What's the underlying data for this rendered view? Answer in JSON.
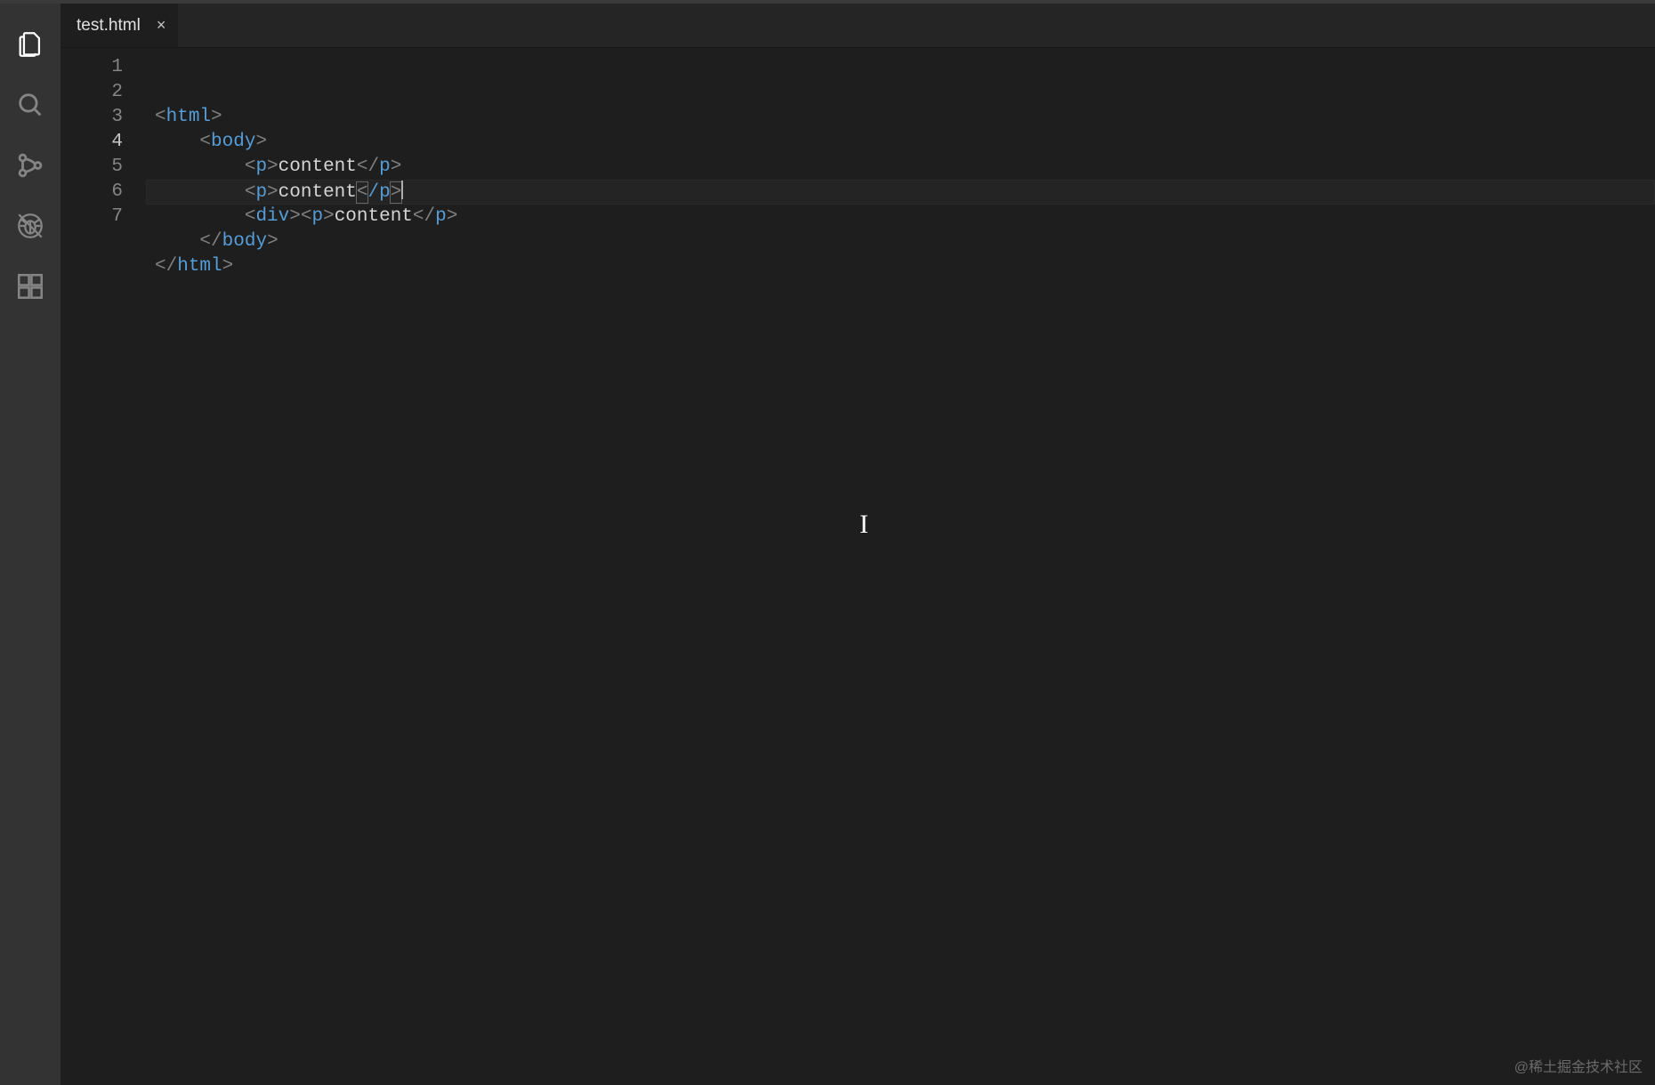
{
  "activitybar": {
    "items": [
      {
        "name": "files-icon",
        "active": true
      },
      {
        "name": "search-icon",
        "active": false
      },
      {
        "name": "source-control-icon",
        "active": false
      },
      {
        "name": "debug-icon",
        "active": false
      },
      {
        "name": "extensions-icon",
        "active": false
      }
    ]
  },
  "tabs": [
    {
      "label": "test.html",
      "active": true,
      "close_icon": "×"
    }
  ],
  "editor": {
    "filename": "test.html",
    "current_line": 4,
    "cursor_col_after_segment": 6,
    "line_numbers": [
      "1",
      "2",
      "3",
      "4",
      "5",
      "6",
      "7"
    ],
    "lines": [
      {
        "indent": 0,
        "segments": [
          {
            "t": "bracket",
            "v": "<"
          },
          {
            "t": "tag",
            "v": "html"
          },
          {
            "t": "bracket",
            "v": ">"
          }
        ]
      },
      {
        "indent": 1,
        "segments": [
          {
            "t": "bracket",
            "v": "<"
          },
          {
            "t": "tag",
            "v": "body"
          },
          {
            "t": "bracket",
            "v": ">"
          }
        ]
      },
      {
        "indent": 2,
        "segments": [
          {
            "t": "bracket",
            "v": "<"
          },
          {
            "t": "tag",
            "v": "p"
          },
          {
            "t": "bracket",
            "v": ">"
          },
          {
            "t": "text",
            "v": "content"
          },
          {
            "t": "bracket",
            "v": "</"
          },
          {
            "t": "tag",
            "v": "p"
          },
          {
            "t": "bracket",
            "v": ">"
          }
        ]
      },
      {
        "indent": 2,
        "current": true,
        "segments": [
          {
            "t": "bracket",
            "v": "<"
          },
          {
            "t": "tag",
            "v": "p"
          },
          {
            "t": "bracket",
            "v": ">"
          },
          {
            "t": "text",
            "v": "content"
          },
          {
            "t": "bracket",
            "v": "<",
            "match": true
          },
          {
            "t": "tag",
            "v": "/p"
          },
          {
            "t": "bracket",
            "v": ">",
            "match": true
          },
          {
            "t": "cursor"
          }
        ]
      },
      {
        "indent": 2,
        "segments": [
          {
            "t": "bracket",
            "v": "<"
          },
          {
            "t": "tag",
            "v": "div"
          },
          {
            "t": "bracket",
            "v": ">"
          },
          {
            "t": "bracket",
            "v": "<"
          },
          {
            "t": "tag",
            "v": "p"
          },
          {
            "t": "bracket",
            "v": ">"
          },
          {
            "t": "text",
            "v": "content"
          },
          {
            "t": "bracket",
            "v": "</"
          },
          {
            "t": "tag",
            "v": "p"
          },
          {
            "t": "bracket",
            "v": ">"
          }
        ]
      },
      {
        "indent": 1,
        "segments": [
          {
            "t": "bracket",
            "v": "</"
          },
          {
            "t": "tag",
            "v": "body"
          },
          {
            "t": "bracket",
            "v": ">"
          }
        ]
      },
      {
        "indent": 0,
        "segments": [
          {
            "t": "bracket",
            "v": "</"
          },
          {
            "t": "tag",
            "v": "html"
          },
          {
            "t": "bracket",
            "v": ">"
          }
        ]
      }
    ]
  },
  "watermark": "@稀土掘金技术社区",
  "ibeam_glyph": "I"
}
